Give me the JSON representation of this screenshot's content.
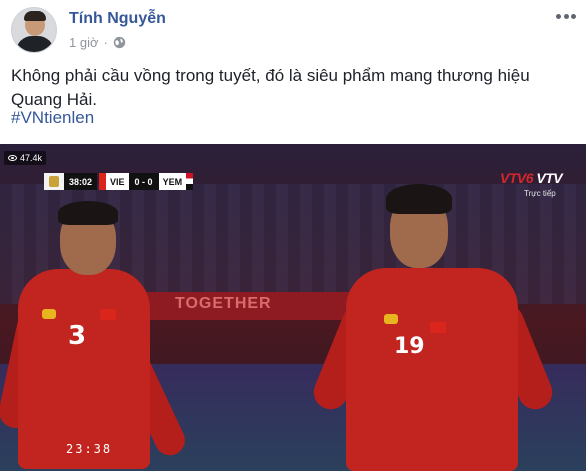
{
  "post": {
    "author": "Tính Nguyễn",
    "time": "1 giờ",
    "separator": "·",
    "text": "Không phải cầu vồng trong tuyết, đó là siêu phẩm mang thương hiệu Quang Hải.",
    "hashtag": "#VNtienlen"
  },
  "video": {
    "views": "47.4k",
    "scoreboard": {
      "time": "38:02",
      "home_team": "VIE",
      "score": "0 - 0",
      "away_team": "YEM"
    },
    "broadcaster_left": "VTV6",
    "broadcaster_right": "VTV",
    "live_label": "Trực tiếp",
    "ad_board": "TOGETHER",
    "clock": "23:38",
    "player_numbers": [
      "3",
      "19"
    ]
  },
  "colors": {
    "author_link": "#365899",
    "meta_gray": "#90949c",
    "jersey_red": "#c2241f"
  },
  "icons": [
    "globe-icon",
    "menu-icon",
    "eye-icon"
  ]
}
